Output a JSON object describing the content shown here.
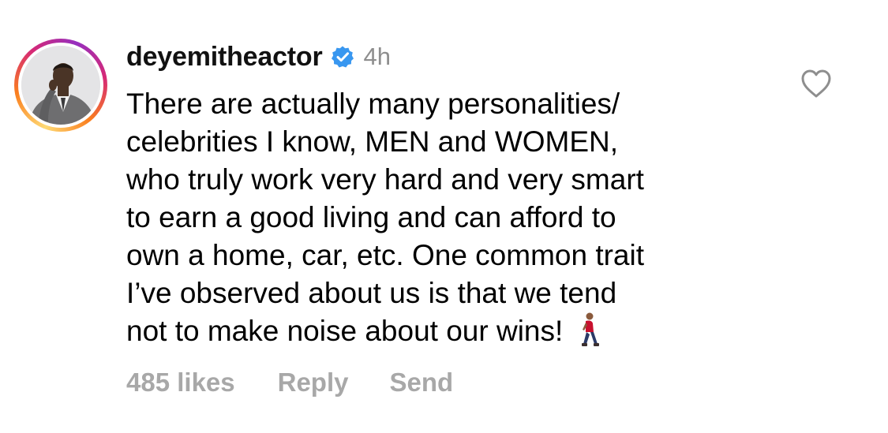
{
  "comment": {
    "username": "deyemitheactor",
    "verified": true,
    "time": "4h",
    "text": "There are actually many personalities/\ncelebrities I know, MEN and WOMEN,\nwho truly work very hard and very smart\nto earn a good living and can afford to\nown a home, car, etc. One common trait\nI’ve observed about us is that we tend\nnot to make noise about our wins!",
    "emoji_icon": "person-walking-icon",
    "likes": "485 likes",
    "reply_label": "Reply",
    "send_label": "Send"
  },
  "colors": {
    "verified_badge": "#3897f0",
    "muted_text": "#8e8e8e",
    "action_text": "#a8a8a8"
  }
}
